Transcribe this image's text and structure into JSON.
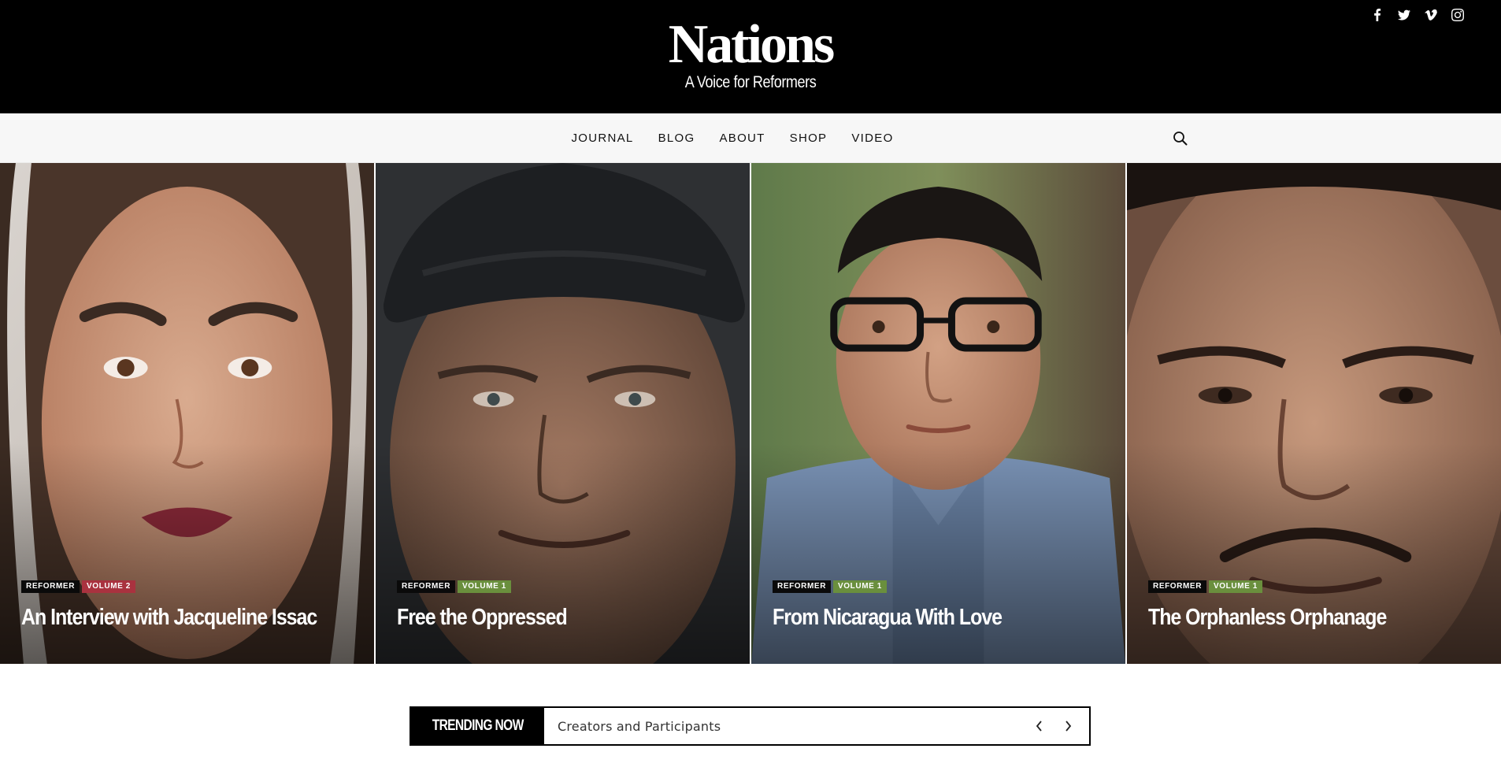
{
  "header": {
    "brand_title": "Nations",
    "brand_tagline": "A Voice for Reformers",
    "social_icons": [
      "facebook-icon",
      "twitter-icon",
      "vimeo-icon",
      "instagram-icon"
    ]
  },
  "nav": {
    "items": [
      {
        "label": "JOURNAL"
      },
      {
        "label": "BLOG"
      },
      {
        "label": "ABOUT"
      },
      {
        "label": "SHOP"
      },
      {
        "label": "VIDEO"
      }
    ],
    "search_icon": "search-icon"
  },
  "featured": [
    {
      "category": "REFORMER",
      "volume": "VOLUME 2",
      "volume_color": "#a9323f",
      "title": "An Interview with Jacqueline Issac"
    },
    {
      "category": "REFORMER",
      "volume": "VOLUME 1",
      "volume_color": "#6a8f3d",
      "title": "Free the Oppressed"
    },
    {
      "category": "REFORMER",
      "volume": "VOLUME 1",
      "volume_color": "#6a8f3d",
      "title": "From Nicaragua With Love"
    },
    {
      "category": "REFORMER",
      "volume": "VOLUME 1",
      "volume_color": "#6a8f3d",
      "title": "The Orphanless Orphanage"
    }
  ],
  "trending": {
    "label": "TRENDING NOW",
    "item": "Creators and Participants",
    "prev_icon": "chevron-left-icon",
    "next_icon": "chevron-right-icon"
  }
}
